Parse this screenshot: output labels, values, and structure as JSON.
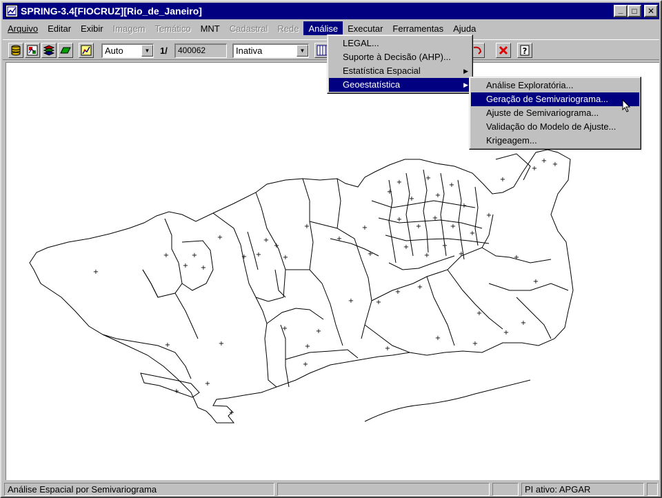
{
  "window": {
    "title": "SPRING-3.4[FIOCRUZ][Rio_de_Janeiro]",
    "minimize_glyph": "_",
    "maximize_glyph": "□",
    "close_glyph": "✕"
  },
  "menubar": {
    "items": [
      {
        "label": "Arquivo",
        "enabled": true
      },
      {
        "label": "Editar",
        "enabled": true
      },
      {
        "label": "Exibir",
        "enabled": true
      },
      {
        "label": "Imagem",
        "enabled": false
      },
      {
        "label": "Temático",
        "enabled": false
      },
      {
        "label": "MNT",
        "enabled": true
      },
      {
        "label": "Cadastral",
        "enabled": false
      },
      {
        "label": "Rede",
        "enabled": false
      },
      {
        "label": "Análise",
        "enabled": true,
        "active": true
      },
      {
        "label": "Executar",
        "enabled": true
      },
      {
        "label": "Ferramentas",
        "enabled": true
      },
      {
        "label": "Ajuda",
        "enabled": true
      }
    ]
  },
  "toolbar": {
    "zoom_mode": "Auto",
    "scale_prefix": "1/",
    "scale_value": "400062",
    "status_combo": "Inativa",
    "icons": [
      "database-icon",
      "image-icon",
      "layers-icon",
      "plane-icon",
      "chart-icon",
      "grid-icon",
      "undo-icon",
      "delete-icon",
      "help-icon"
    ]
  },
  "analise_menu": {
    "items": [
      {
        "label": "LEGAL...",
        "has_submenu": false
      },
      {
        "label": "Suporte à Decisão (AHP)...",
        "has_submenu": false
      },
      {
        "label": "Estatística Espacial",
        "has_submenu": true
      },
      {
        "label": "Geoestatística",
        "has_submenu": true,
        "highlighted": true
      }
    ]
  },
  "geo_submenu": {
    "items": [
      {
        "label": "Análise Exploratória...",
        "highlighted": false
      },
      {
        "label": "Geração de Semivariograma...",
        "highlighted": true
      },
      {
        "label": "Ajuste de Semivariograma...",
        "highlighted": false
      },
      {
        "label": "Validação do Modelo de Ajuste...",
        "highlighted": false
      },
      {
        "label": "Krigeagem...",
        "highlighted": false
      }
    ]
  },
  "map": {
    "point_symbol": "+",
    "outline_color": "#000000",
    "background_color": "#ffffff"
  },
  "statusbar": {
    "message": "Análise Espacial por Semivariograma",
    "empty_cell": "",
    "active_pi": "PI ativo: APGAR"
  }
}
